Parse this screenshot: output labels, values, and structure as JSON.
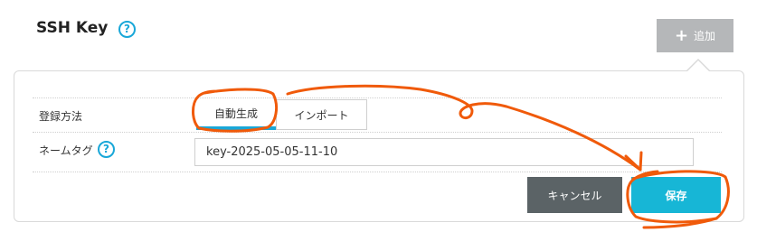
{
  "header": {
    "title": "SSH Key",
    "help_glyph": "?",
    "add_button": {
      "icon": "plus-icon",
      "icon_glyph": "+",
      "label": "追加"
    }
  },
  "form": {
    "method": {
      "label": "登録方法",
      "tabs": [
        {
          "label": "自動生成",
          "active": true
        },
        {
          "label": "インポート",
          "active": false
        }
      ]
    },
    "name_tag": {
      "label": "ネームタグ",
      "help_glyph": "?",
      "value": "key-2025-05-05-11-10"
    },
    "buttons": {
      "cancel": "キャンセル",
      "save": "保存"
    }
  },
  "colors": {
    "accent": "#19a7d8",
    "save_button": "#17b6d6",
    "cancel_button": "#5b6366",
    "add_button": "#b5b7b9",
    "annotation": "#f05a0a"
  }
}
